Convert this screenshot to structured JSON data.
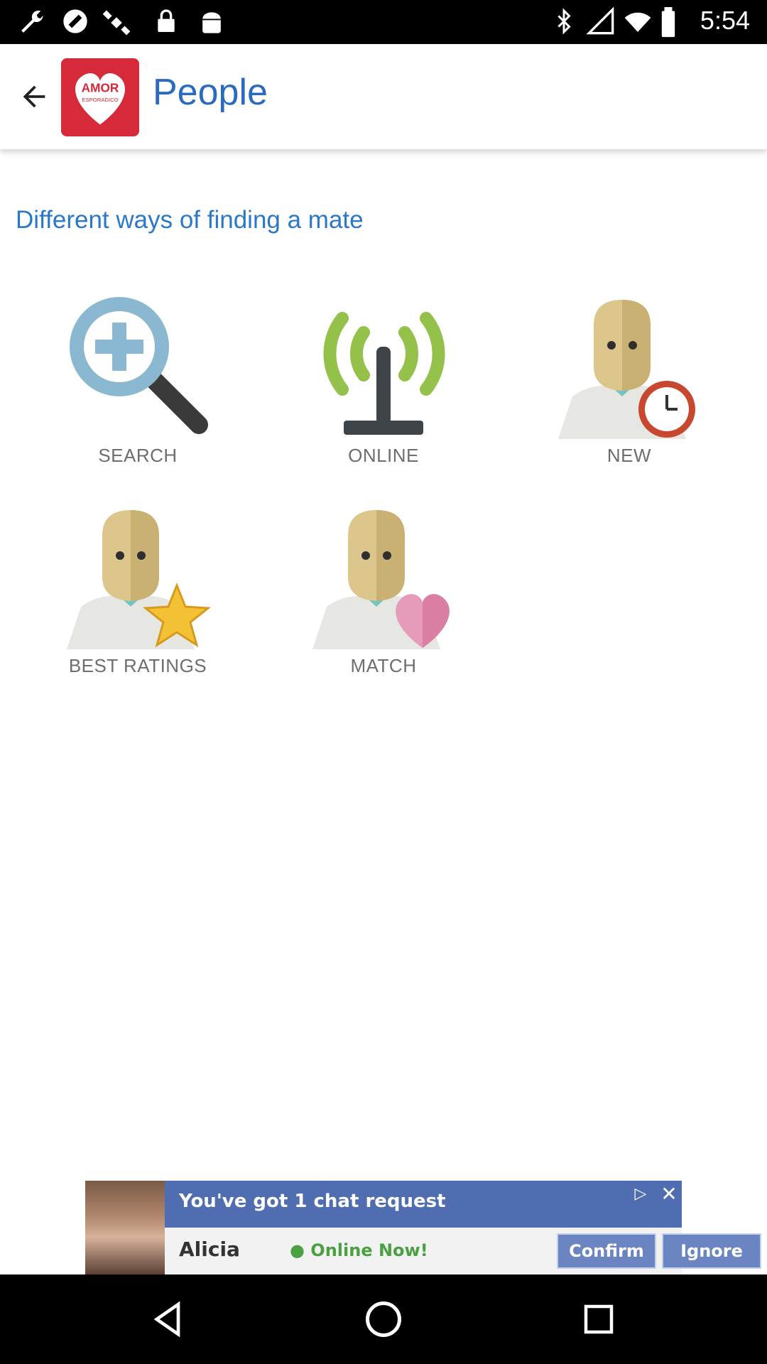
{
  "status_bar": {
    "time": "5:54"
  },
  "app_bar": {
    "title": "People",
    "logo": {
      "line1": "AMOR",
      "line2": "ESPORADICO"
    }
  },
  "content": {
    "subtitle": "Different ways of finding a mate",
    "options": [
      {
        "label": "SEARCH",
        "icon": "search-plus-icon"
      },
      {
        "label": "ONLINE",
        "icon": "antenna-icon"
      },
      {
        "label": "NEW",
        "icon": "person-clock-icon"
      },
      {
        "label": "BEST RATINGS",
        "icon": "person-star-icon"
      },
      {
        "label": "MATCH",
        "icon": "person-heart-icon"
      }
    ]
  },
  "ad_banner": {
    "headline": "You've got 1 chat request",
    "name": "Alicia",
    "status": "Online Now!",
    "confirm_label": "Confirm",
    "ignore_label": "Ignore"
  },
  "colors": {
    "title": "#2a6bc1",
    "subtitle": "#2a78c7",
    "logo_bg": "#d6293a",
    "ad_bg": "#4f6db0"
  }
}
